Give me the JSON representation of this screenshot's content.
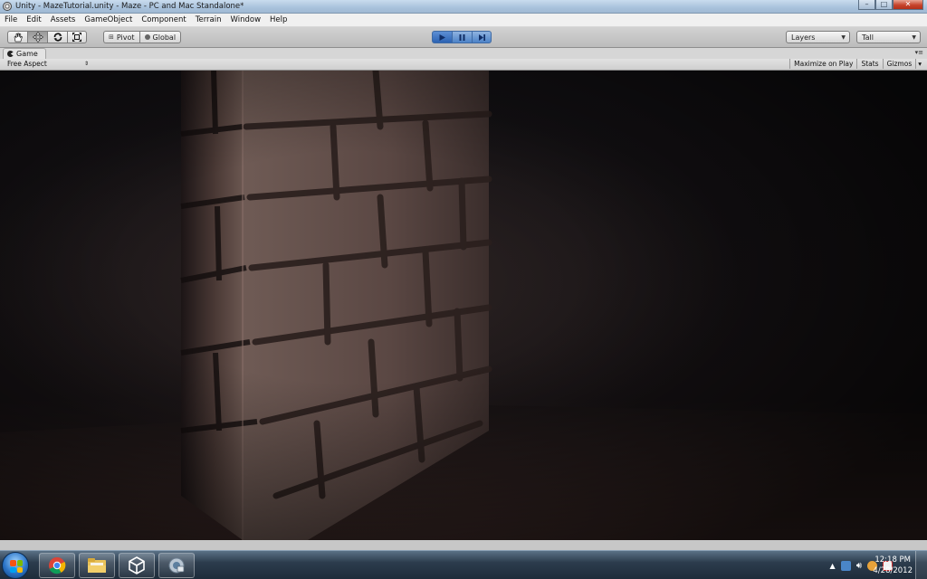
{
  "window": {
    "title": "Unity - MazeTutorial.unity - Maze - PC and Mac Standalone*",
    "icon": "unity-logo-icon",
    "controls": {
      "minimize": "–",
      "maximize": "□",
      "close": "✕"
    }
  },
  "menubar": {
    "items": [
      "File",
      "Edit",
      "Assets",
      "GameObject",
      "Component",
      "Terrain",
      "Window",
      "Help"
    ]
  },
  "toolbar": {
    "tools": [
      {
        "name": "hand-tool",
        "icon": "hand-icon"
      },
      {
        "name": "move-tool",
        "icon": "move-arrows-icon",
        "selected": true
      },
      {
        "name": "rotate-tool",
        "icon": "rotate-icon"
      },
      {
        "name": "scale-tool",
        "icon": "scale-icon"
      }
    ],
    "pivot_label": "Pivot",
    "global_label": "Global",
    "playback": [
      {
        "name": "play-button",
        "icon": "play-icon",
        "active": true
      },
      {
        "name": "pause-button",
        "icon": "pause-icon"
      },
      {
        "name": "step-button",
        "icon": "step-icon"
      }
    ],
    "layers_label": "Layers",
    "layout_label": "Tall"
  },
  "game_view": {
    "tab_label": "Game",
    "aspect_label": "Free Aspect",
    "buttons": {
      "maximize": "Maximize on Play",
      "stats": "Stats",
      "gizmos": "Gizmos"
    }
  },
  "taskbar": {
    "apps": [
      "chrome-icon",
      "file-explorer-icon",
      "unity-icon",
      "network-app-icon"
    ],
    "tray_icons": [
      "tray-up-arrow-icon",
      "tray-app-icon",
      "volume-icon",
      "tray-status-icon",
      "action-center-flag-icon"
    ],
    "time": "12:18 PM",
    "date": "4/28/2012"
  }
}
